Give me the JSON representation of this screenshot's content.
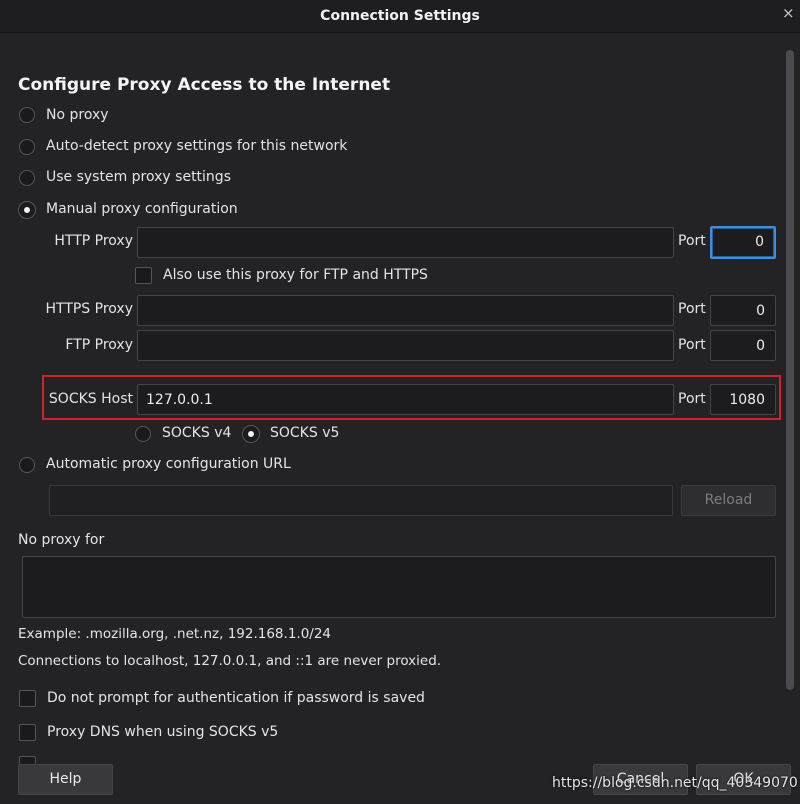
{
  "window": {
    "title": "Connection Settings",
    "close_glyph": "×"
  },
  "section_heading": "Configure Proxy Access to the Internet",
  "proxy_options": {
    "no_proxy": "No proxy",
    "auto_detect": "Auto-detect proxy settings for this network",
    "system": "Use system proxy settings",
    "manual": "Manual proxy configuration",
    "auto_url": "Automatic proxy configuration URL",
    "selected": "manual"
  },
  "manual": {
    "http_label": "HTTP Proxy",
    "http_value": "",
    "http_port_label": "Port",
    "http_port": "0",
    "also_use_label": "Also use this proxy for FTP and HTTPS",
    "https_label": "HTTPS Proxy",
    "https_value": "",
    "https_port_label": "Port",
    "https_port": "0",
    "ftp_label": "FTP Proxy",
    "ftp_value": "",
    "ftp_port_label": "Port",
    "ftp_port": "0",
    "socks_label": "SOCKS Host",
    "socks_value": "127.0.0.1",
    "socks_port_label": "Port",
    "socks_port": "1080",
    "socks_v4": "SOCKS v4",
    "socks_v5": "SOCKS v5",
    "socks_version_selected": "v5"
  },
  "auto_url": {
    "value": "",
    "reload_label": "Reload"
  },
  "no_proxy_for": {
    "label": "No proxy for",
    "value": ""
  },
  "example_text": "Example: .mozilla.org, .net.nz, 192.168.1.0/24",
  "localhost_note": "Connections to localhost, 127.0.0.1, and ::1 are never proxied.",
  "options": {
    "no_prompt_auth": "Do not prompt for authentication if password is saved",
    "proxy_dns": "Proxy DNS when using SOCKS v5"
  },
  "buttons": {
    "help": "Help",
    "cancel": "Cancel",
    "ok": "OK"
  },
  "watermark": "https://blog.csdn.net/qq_40349070",
  "colors": {
    "accent": "#3d8ee0",
    "highlight": "#d0222a"
  }
}
